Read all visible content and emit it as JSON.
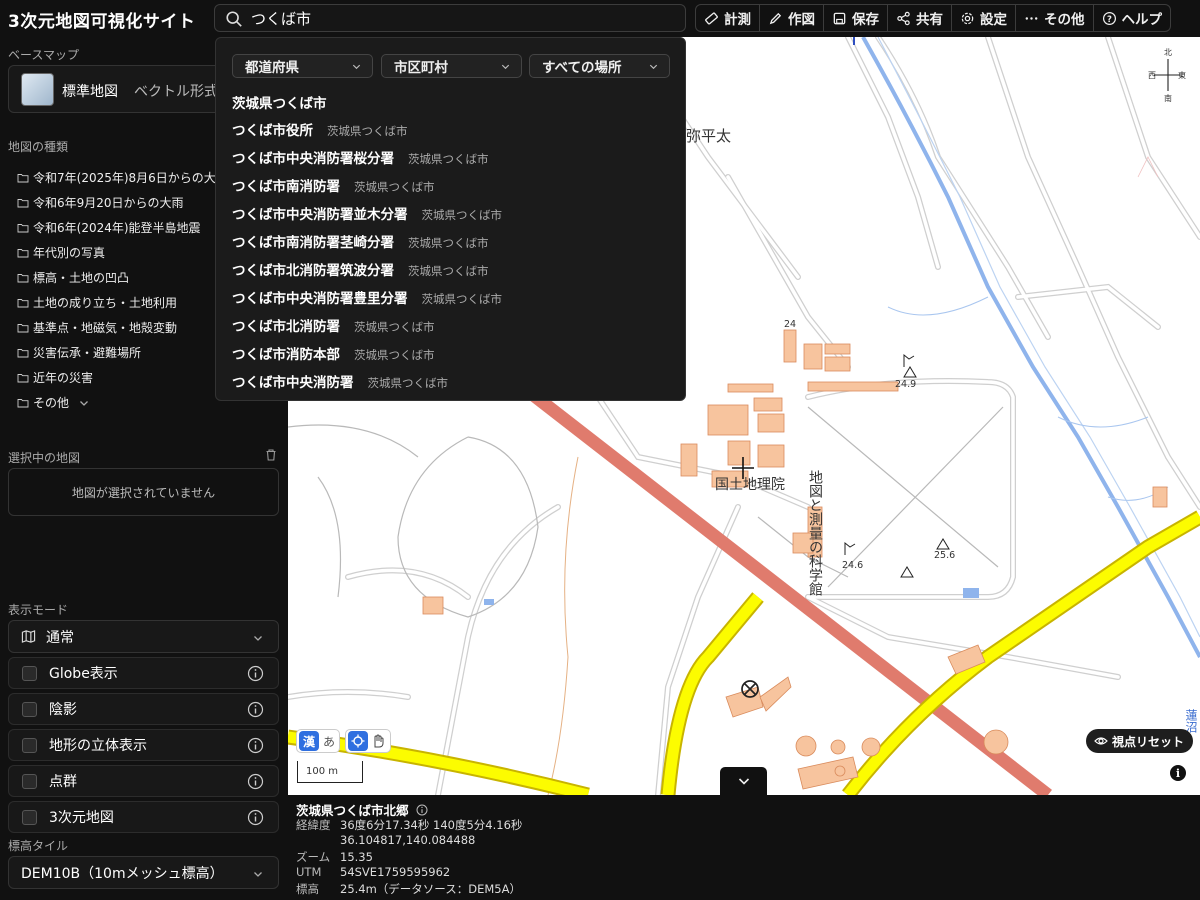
{
  "app": {
    "title": "3次元地図可視化サイト"
  },
  "search": {
    "value": "つくば市",
    "placeholder": ""
  },
  "toolbar": [
    {
      "label": "計測",
      "icon": "ruler-icon"
    },
    {
      "label": "作図",
      "icon": "pencil-icon"
    },
    {
      "label": "保存",
      "icon": "save-icon"
    },
    {
      "label": "共有",
      "icon": "share-icon"
    },
    {
      "label": "設定",
      "icon": "gear-icon"
    },
    {
      "label": "その他",
      "icon": "more-icon"
    },
    {
      "label": "ヘルプ",
      "icon": "help-icon"
    }
  ],
  "sidebar": {
    "basemap_label": "ベースマップ",
    "basemap_name": "標準地図",
    "basemap_type": "ベクトル形式",
    "maptypes_label": "地図の種類",
    "maptypes": [
      "令和7年(2025年)8月6日からの大雨",
      "令和6年9月20日からの大雨",
      "令和6年(2024年)能登半島地震",
      "年代別の写真",
      "標高・土地の凹凸",
      "土地の成り立ち・土地利用",
      "基準点・地磁気・地殻変動",
      "災害伝承・避難場所",
      "近年の災害",
      "その他"
    ],
    "selected_label": "選択中の地図",
    "selected_empty": "地図が選択されていません",
    "displaymode_label": "表示モード",
    "displaymode_value": "通常",
    "options": [
      "Globe表示",
      "陰影",
      "地形の立体表示",
      "点群",
      "3次元地図"
    ],
    "elevation_label": "標高タイル",
    "elevation_value": "DEM10B（10mメッシュ標高）"
  },
  "dropdown": {
    "filters": [
      "都道府県",
      "市区町村",
      "すべての場所"
    ],
    "header": "茨城県つくば市",
    "results": [
      {
        "name": "つくば市役所",
        "loc": "茨城県つくば市"
      },
      {
        "name": "つくば市中央消防署桜分署",
        "loc": "茨城県つくば市"
      },
      {
        "name": "つくば市南消防署",
        "loc": "茨城県つくば市"
      },
      {
        "name": "つくば市中央消防署並木分署",
        "loc": "茨城県つくば市"
      },
      {
        "name": "つくば市南消防署茎崎分署",
        "loc": "茨城県つくば市"
      },
      {
        "name": "つくば市北消防署筑波分署",
        "loc": "茨城県つくば市"
      },
      {
        "name": "つくば市中央消防署豊里分署",
        "loc": "茨城県つくば市"
      },
      {
        "name": "つくば市北消防署",
        "loc": "茨城県つくば市"
      },
      {
        "name": "つくば市消防本部",
        "loc": "茨城県つくば市"
      },
      {
        "name": "つくば市中央消防署",
        "loc": "茨城県つくば市"
      }
    ]
  },
  "map": {
    "labels": {
      "gsi": "国土地理院",
      "museum": "地図と測量の科学館",
      "place": "北弥平太",
      "elev1": "24.9",
      "elev2": "24.6",
      "elev3": "25.6",
      "elev4": "24",
      "compass_n": "北",
      "compass_e": "東",
      "compass_w": "西",
      "compass_s": "南",
      "edge_text": "蓮沼"
    },
    "scale": "100 m",
    "reset_label": "視点リセット",
    "kanji_toggle": "漢",
    "kana_toggle": "あ"
  },
  "info": {
    "title": "茨城県つくば市北郷",
    "rows": [
      {
        "k": "経緯度",
        "v": "36度6分17.34秒 140度5分4.16秒"
      },
      {
        "k": "",
        "v": "36.104817,140.084488"
      },
      {
        "k": "ズーム",
        "v": "15.35"
      },
      {
        "k": "UTM",
        "v": "54SVE1759595962"
      },
      {
        "k": "標高",
        "v": "25.4m（データソース：DEM5A）"
      }
    ]
  },
  "colors": {
    "accent": "#2f6fe0",
    "highway": "#fcfc00",
    "rail": "#e07b6d",
    "building": "#f7c49e",
    "water": "#8fb4ec"
  }
}
